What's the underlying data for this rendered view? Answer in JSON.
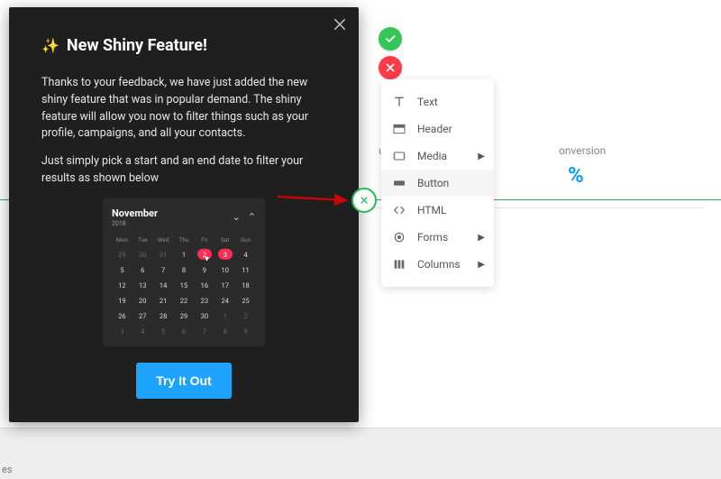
{
  "modal": {
    "title": "New Shiny Feature!",
    "p1": "Thanks to your feedback, we have just added the new shiny feature that was in popular demand. The shiny feature will allow you now to filter things such as your profile, campaigns, and all your contacts.",
    "p2": "Just simply pick a start and an end date to filter your results as shown below",
    "cta": "Try It Out",
    "calendar": {
      "month": "November",
      "year": "2018",
      "dow": [
        "Mon",
        "Tue",
        "Wed",
        "Thu",
        "Fri",
        "Sat",
        "Sun"
      ],
      "cells": [
        {
          "d": "29",
          "dim": true
        },
        {
          "d": "30",
          "dim": true
        },
        {
          "d": "31",
          "dim": true
        },
        {
          "d": "1"
        },
        {
          "d": "2",
          "picked": true,
          "cursor": true
        },
        {
          "d": "3",
          "picked": true
        },
        {
          "d": "4"
        },
        {
          "d": "5"
        },
        {
          "d": "6"
        },
        {
          "d": "7"
        },
        {
          "d": "8"
        },
        {
          "d": "9"
        },
        {
          "d": "10"
        },
        {
          "d": "11"
        },
        {
          "d": "12"
        },
        {
          "d": "13"
        },
        {
          "d": "14"
        },
        {
          "d": "15"
        },
        {
          "d": "16"
        },
        {
          "d": "17"
        },
        {
          "d": "18"
        },
        {
          "d": "19"
        },
        {
          "d": "20"
        },
        {
          "d": "21"
        },
        {
          "d": "22"
        },
        {
          "d": "23"
        },
        {
          "d": "24"
        },
        {
          "d": "25"
        },
        {
          "d": "26"
        },
        {
          "d": "27"
        },
        {
          "d": "28"
        },
        {
          "d": "29"
        },
        {
          "d": "30"
        },
        {
          "d": "1",
          "dim": true
        },
        {
          "d": "2",
          "dim": true
        },
        {
          "d": "3",
          "dim": true
        },
        {
          "d": "4",
          "dim": true
        },
        {
          "d": "5",
          "dim": true
        },
        {
          "d": "6",
          "dim": true
        },
        {
          "d": "7",
          "dim": true
        },
        {
          "d": "8",
          "dim": true
        },
        {
          "d": "9",
          "dim": true
        }
      ]
    }
  },
  "bg": {
    "label1": "ured",
    "label2": "onversion",
    "stat": "%",
    "bottom": "es"
  },
  "tools": [
    {
      "name": "text",
      "label": "Text"
    },
    {
      "name": "header",
      "label": "Header"
    },
    {
      "name": "media",
      "label": "Media",
      "sub": true
    },
    {
      "name": "button",
      "label": "Button",
      "sel": true
    },
    {
      "name": "html",
      "label": "HTML"
    },
    {
      "name": "forms",
      "label": "Forms",
      "sub": true
    },
    {
      "name": "columns",
      "label": "Columns",
      "sub": true
    }
  ]
}
